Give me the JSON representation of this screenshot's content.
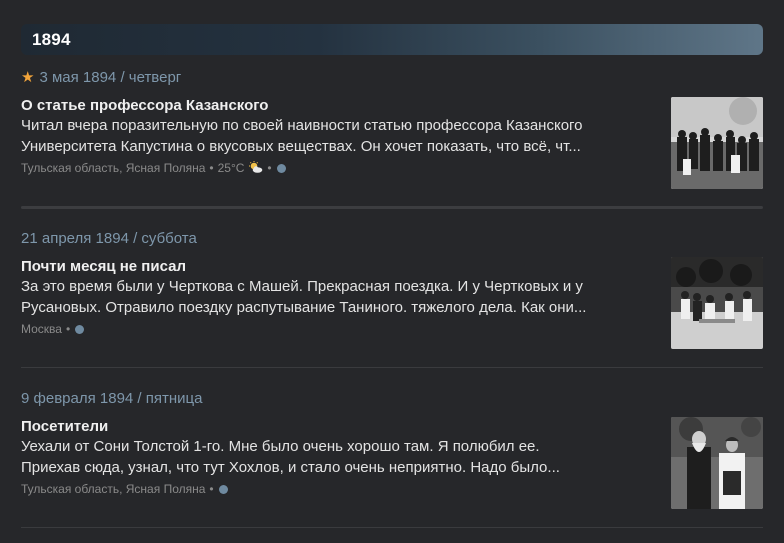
{
  "year_header": "1894",
  "entries": [
    {
      "date": "3 мая 1894 / четверг",
      "starred": true,
      "title": "О статье профессора Казанского",
      "text_line1": "Читал вчера поразительную по своей наивности статью профессора Казанского",
      "text_line2": "Университета Капустина о вкусовых веществах. Он хочет показать, что всё, чт...",
      "location": "Тульская область, Ясная Поляна",
      "weather": "25°C",
      "weather_icon": "sun-cloud-icon",
      "photo_icon": "group-photo-icon"
    },
    {
      "date": "21 апреля 1894 / суббота",
      "starred": false,
      "title": "Почти месяц не писал",
      "text_line1": "За это время были у Черткова с Машей. Прекрасная поездка. И у Чертковых и у",
      "text_line2": "Русановых. Отравило поездку распутывание Таниного. тяжелого дела. Как они...",
      "location": "Москва",
      "photo_icon": "outdoor-group-photo-icon"
    },
    {
      "date": "9 февраля 1894 / пятница",
      "starred": false,
      "title": "Посетители",
      "text_line1": "Уехали от Сони Толстой 1-го. Мне было очень хорошо там. Я полюбил ее.",
      "text_line2": "Приехав сюда, узнал, что тут Хохлов, и стало очень неприятно. Надо было...",
      "location": "Тульская область, Ясная Поляна",
      "photo_icon": "couple-photo-icon"
    }
  ],
  "colors": {
    "accent": "#7e97ab",
    "star": "#f2a43a",
    "dot": "#6f8aa0",
    "background": "#26272a"
  }
}
